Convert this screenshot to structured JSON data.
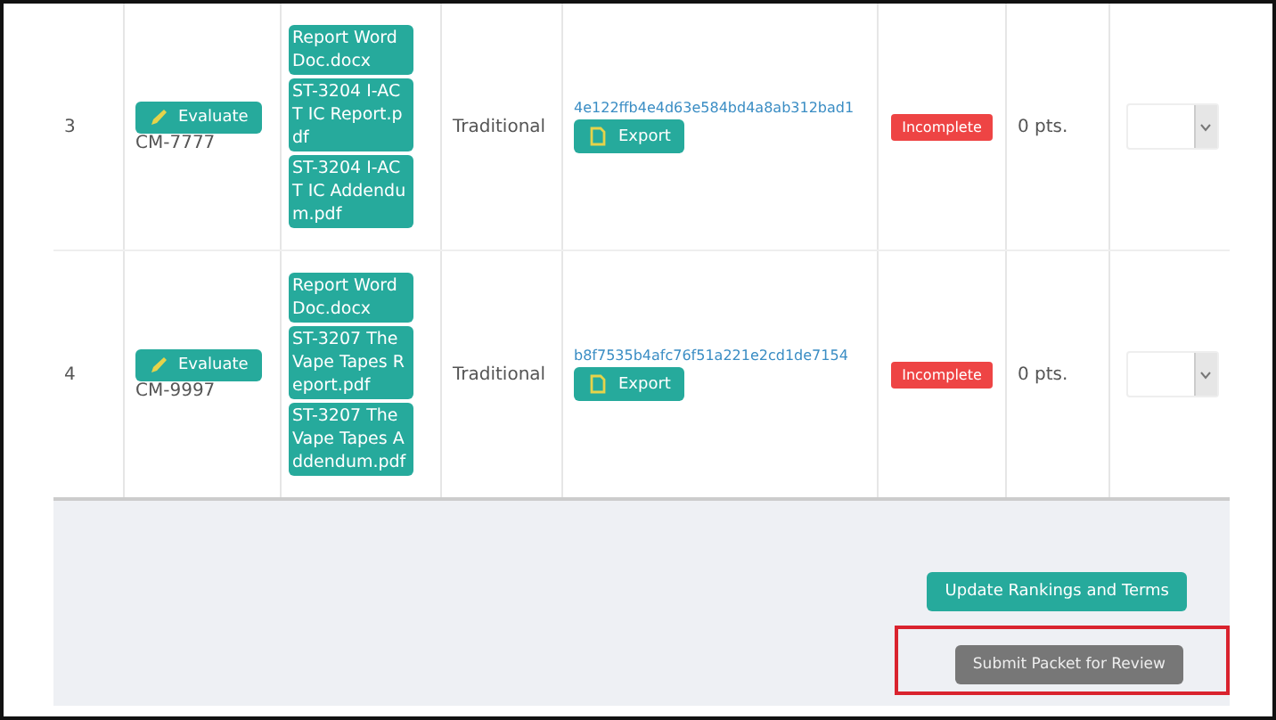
{
  "rows": [
    {
      "number": "3",
      "evaluate": "Evaluate",
      "code": "CM-7777",
      "files": [
        "Report Word Doc.docx",
        "ST-3204 I-ACT IC Report.pdf",
        "ST-3204 I-ACT IC Addendum.pdf"
      ],
      "type": "Traditional",
      "hash": "4e122ffb4e4d63e584bd4a8ab312bad1",
      "export": "Export",
      "status": "Incomplete",
      "points": "0 pts."
    },
    {
      "number": "4",
      "evaluate": "Evaluate",
      "code": "CM-9997",
      "files": [
        "Report Word Doc.docx",
        "ST-3207 The Vape Tapes Report.pdf",
        "ST-3207 The Vape Tapes Addendum.pdf"
      ],
      "type": "Traditional",
      "hash": "b8f7535b4afc76f51a221e2cd1de7154",
      "export": "Export",
      "status": "Incomplete",
      "points": "0 pts."
    }
  ],
  "actions": {
    "update": "Update Rankings and Terms",
    "submit": "Submit Packet for Review",
    "submit_highlighted": true
  }
}
